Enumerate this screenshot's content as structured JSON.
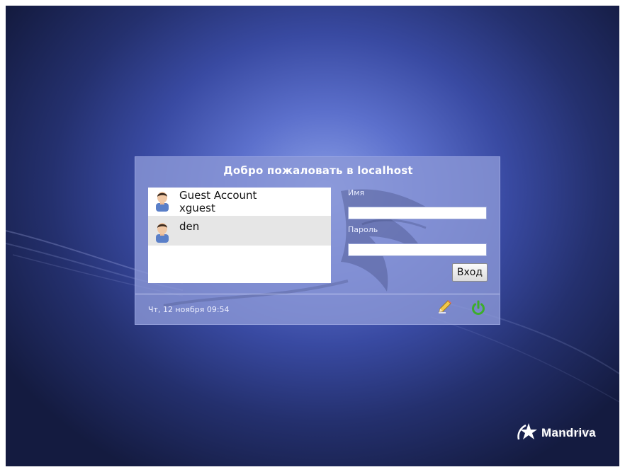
{
  "greeter": {
    "title": "Добро пожаловать в localhost",
    "users": [
      {
        "display_name": "Guest Account",
        "login": "xguest"
      },
      {
        "display_name": "den"
      }
    ],
    "username_label": "Имя",
    "username_value": "",
    "password_label": "Пароль",
    "password_value": "",
    "login_button": "Вход",
    "datetime": "Чт, 12 ноября 09:54",
    "icons": {
      "session_menu": "pencil-icon",
      "shutdown": "power-icon"
    }
  },
  "branding": {
    "logo_text": "Mandriva"
  },
  "colors": {
    "background": "#3a4aa3",
    "panel": "#8c98d7",
    "power_icon": "#3cae2a",
    "selected_row": "#e6e6e6"
  }
}
